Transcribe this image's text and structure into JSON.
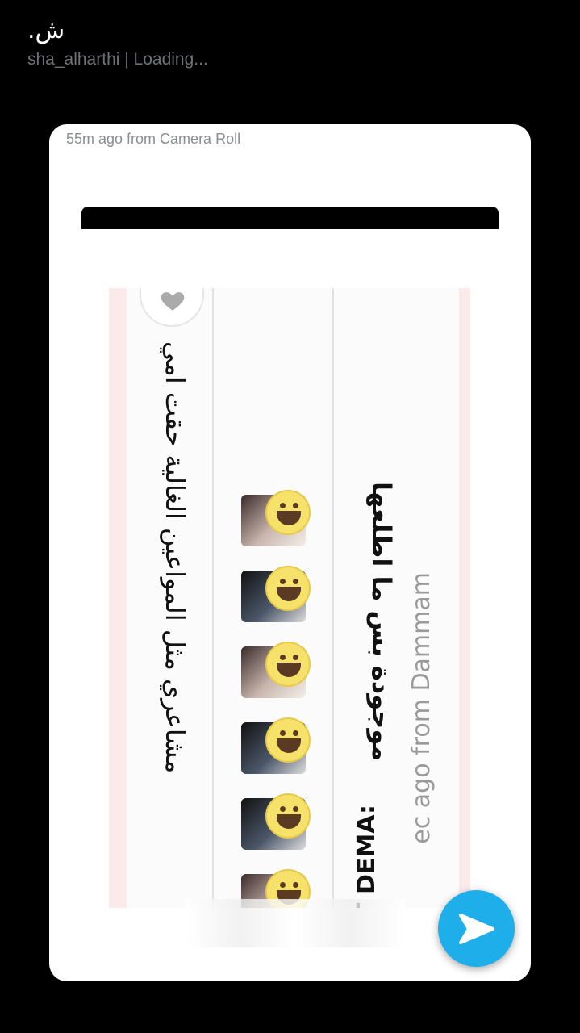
{
  "header": {
    "title": "ش.",
    "subtitle": "sha_alharthi | Loading..."
  },
  "card": {
    "caption": "55m ago from Camera Roll",
    "screenshot": {
      "poem_text": "مشاعري مثل المواعين الغالية حقت امي",
      "comment_text": "موجودة بس ما اطلعها",
      "comment_author": "T DEMA:",
      "comment_meta": "ec ago from Dammam",
      "avatar_count": 6
    }
  },
  "send_button": {
    "icon": "send-arrow-icon",
    "color": "#1eaeea"
  }
}
